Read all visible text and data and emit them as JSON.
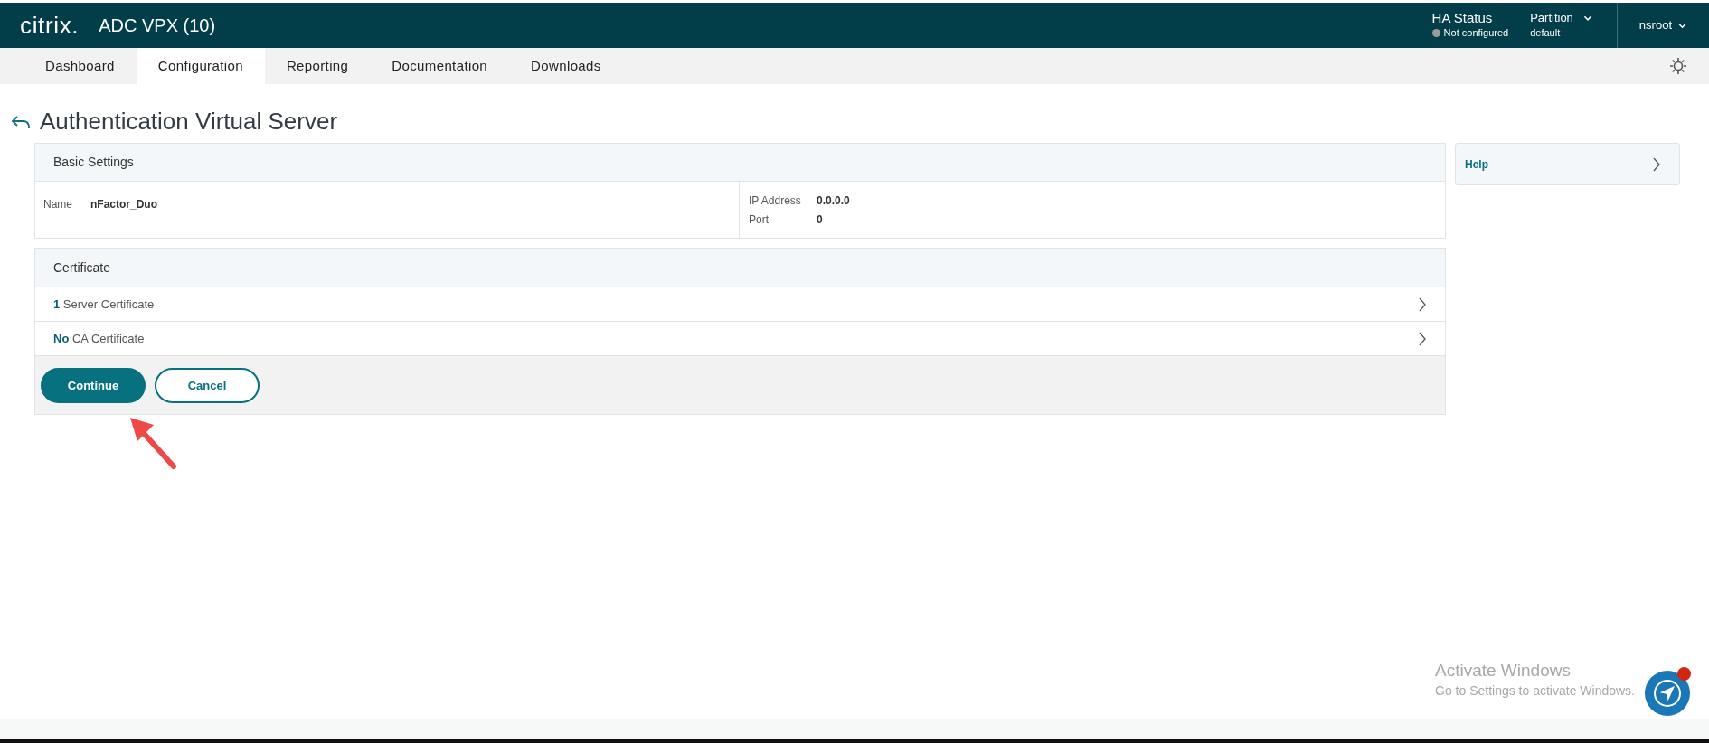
{
  "header": {
    "logo": "citrix.",
    "product": "ADC VPX (10)",
    "ha_status": {
      "label": "HA Status",
      "value": "Not configured"
    },
    "partition": {
      "label": "Partition",
      "value": "default"
    },
    "user": "nsroot"
  },
  "tabs": [
    {
      "label": "Dashboard",
      "selected": false
    },
    {
      "label": "Configuration",
      "selected": true
    },
    {
      "label": "Reporting",
      "selected": false
    },
    {
      "label": "Documentation",
      "selected": false
    },
    {
      "label": "Downloads",
      "selected": false
    }
  ],
  "page_title": "Authentication Virtual Server",
  "basic_settings": {
    "title": "Basic Settings",
    "name_label": "Name",
    "name_value": "nFactor_Duo",
    "fields": [
      {
        "label": "IP Address",
        "value": "0.0.0.0"
      },
      {
        "label": "Port",
        "value": "0"
      }
    ]
  },
  "certificate": {
    "title": "Certificate",
    "rows": [
      {
        "count": "1",
        "label": "Server Certificate"
      },
      {
        "count": "No",
        "label": "CA Certificate"
      }
    ]
  },
  "buttons": [
    {
      "label": "Continue",
      "kind": "primary"
    },
    {
      "label": "Cancel",
      "kind": "secondary"
    }
  ],
  "help": {
    "label": "Help"
  },
  "os_notice": {
    "title": "Activate Windows",
    "text": "Go to Settings to activate Windows."
  }
}
